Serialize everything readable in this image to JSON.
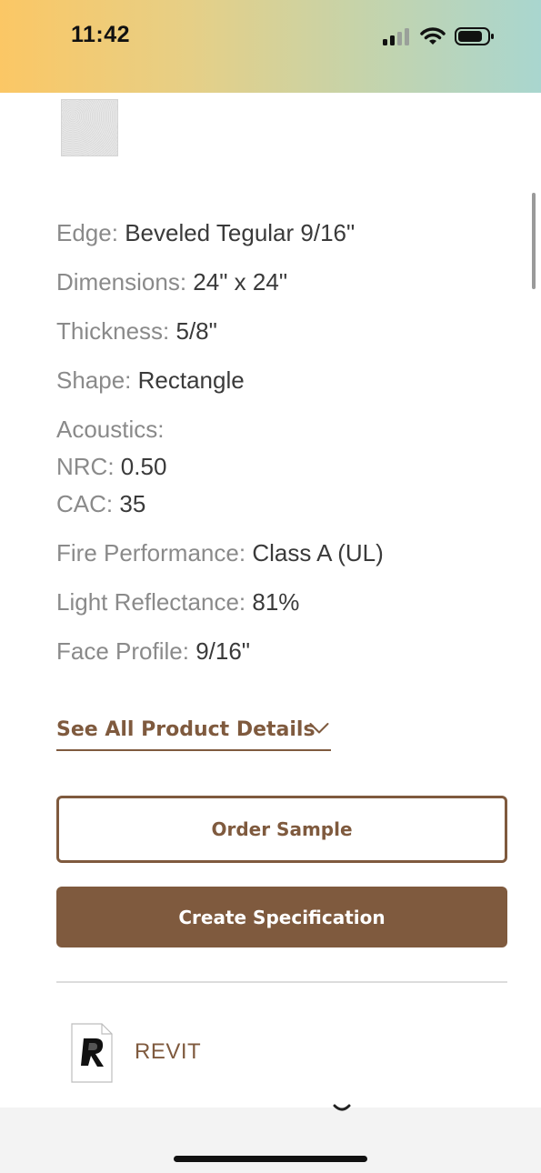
{
  "status_bar": {
    "time": "11:42",
    "icons": [
      "signal-icon",
      "wifi-icon",
      "battery-icon"
    ]
  },
  "product": {
    "thumbnail": "product-swatch-image",
    "specs": [
      {
        "label": "Edge:",
        "value": "Beveled Tegular 9/16\""
      },
      {
        "label": "Dimensions:",
        "value": "24\" x 24\""
      },
      {
        "label": "Thickness:",
        "value": "5/8\""
      },
      {
        "label": "Shape:",
        "value": "Rectangle"
      },
      {
        "label": "Acoustics:",
        "value": ""
      },
      {
        "label": "NRC:",
        "value": "0.50"
      },
      {
        "label": "CAC:",
        "value": "35"
      },
      {
        "label": "Fire Performance:",
        "value": "Class A (UL)"
      },
      {
        "label": "Light Reflectance:",
        "value": "81%"
      },
      {
        "label": "Face Profile:",
        "value": "9/16\""
      }
    ]
  },
  "actions": {
    "details_link": "See All Product Details",
    "order_sample": "Order Sample",
    "create_specification": "Create Specification"
  },
  "downloads": [
    {
      "label": "REVIT",
      "icon": "revit-file-icon"
    }
  ],
  "colors": {
    "accent": "#7f5a3e",
    "label_gray": "#8a8a8a",
    "value_dark": "#3a3a3a"
  }
}
